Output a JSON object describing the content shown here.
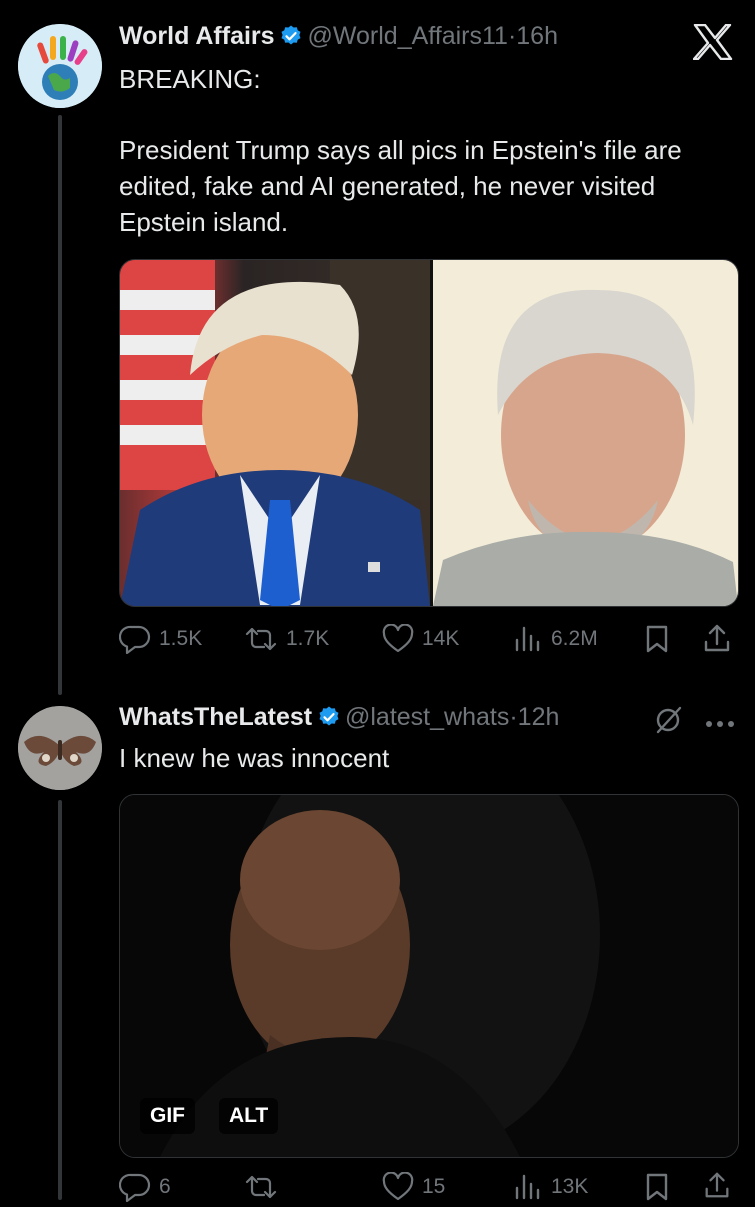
{
  "tweet1": {
    "author_name": "World Affairs",
    "handle": "@World_Affairs11",
    "time": "·16h",
    "headline": "BREAKING:",
    "text": "President Trump says all pics in Epstein's file are edited, fake and AI generated, he never visited Epstein island.",
    "stats": {
      "replies": "1.5K",
      "reposts": "1.7K",
      "likes": "14K",
      "views": "6.2M"
    }
  },
  "tweet2": {
    "author_name": "WhatsTheLatest",
    "handle": "@latest_whats",
    "time": "·12h",
    "text": "I knew he was innocent",
    "gif_badge": "GIF",
    "alt_badge": "ALT",
    "stats": {
      "replies": "6",
      "reposts": "",
      "likes": "15",
      "views": "13K"
    }
  },
  "colors": {
    "background": "#000000",
    "text": "#e7e9ea",
    "muted": "#71767b",
    "verified": "#1d9bf0"
  },
  "icons": [
    "x-logo-icon",
    "verified-badge-icon",
    "reply-icon",
    "repost-icon",
    "like-icon",
    "views-icon",
    "bookmark-icon",
    "share-icon",
    "grok-icon",
    "more-icon"
  ]
}
